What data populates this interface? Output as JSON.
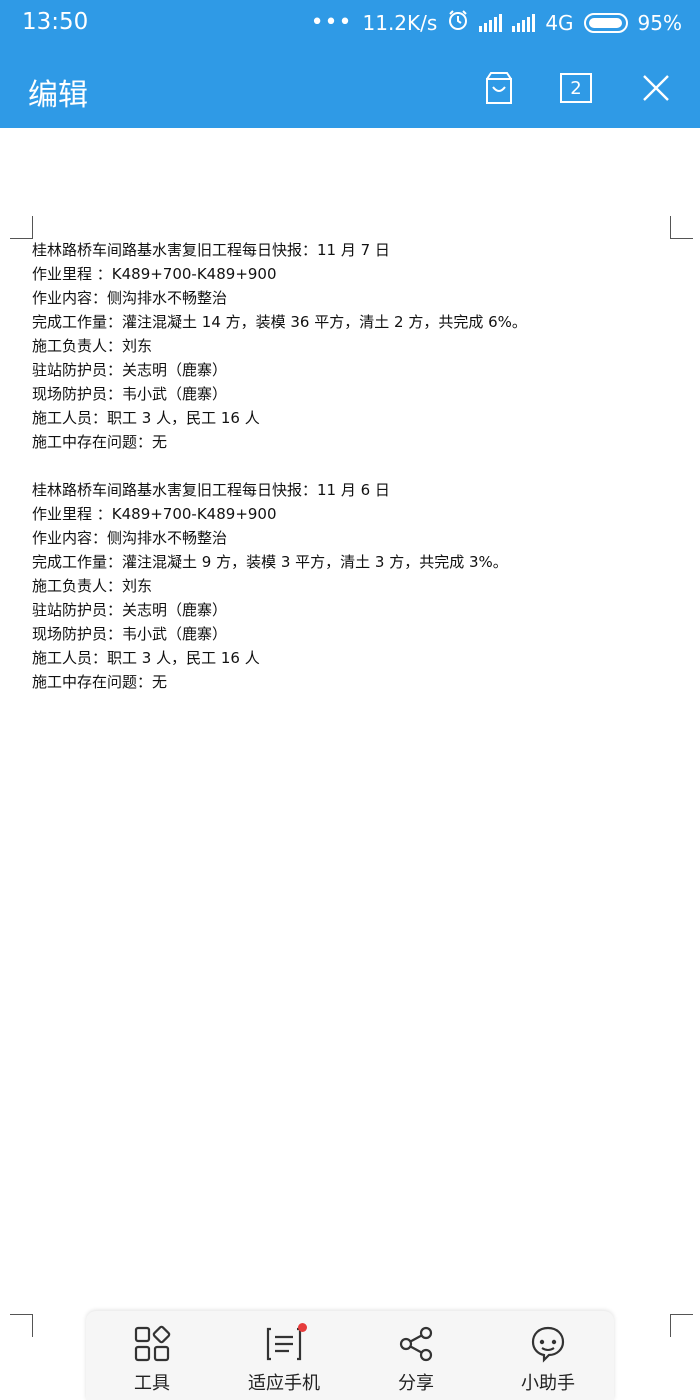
{
  "status_bar": {
    "time": "13:50",
    "dots": "•••",
    "net_speed": "11.2K/s",
    "network": "4G",
    "battery": "95%"
  },
  "app_bar": {
    "title": "编辑",
    "page_count": "2",
    "icons": [
      "save-icon",
      "pages-icon",
      "close-icon"
    ]
  },
  "document": {
    "reports": [
      {
        "lines": [
          "桂林路桥车间路基水害复旧工程每日快报：11 月 7 日",
          "作业里程 ：K489+700-K489+900",
          "作业内容：侧沟排水不畅整治",
          "完成工作量：灌注混凝土 14 方，装模 36 平方，清土 2 方，共完成 6%。",
          "施工负责人：刘东",
          "驻站防护员：关志明（鹿寨）",
          "现场防护员：韦小武（鹿寨）",
          "施工人员：职工 3 人，民工 16 人",
          "施工中存在问题：无"
        ]
      },
      {
        "lines": [
          "桂林路桥车间路基水害复旧工程每日快报：11 月 6 日",
          "作业里程 ：K489+700-K489+900",
          "作业内容：侧沟排水不畅整治",
          "完成工作量：灌注混凝土 9 方，装模 3 平方，清土 3 方，共完成 3%。",
          "施工负责人：刘东",
          "驻站防护员：关志明（鹿寨）",
          "现场防护员：韦小武（鹿寨）",
          "施工人员：职工 3 人，民工 16 人",
          "施工中存在问题：无"
        ]
      }
    ]
  },
  "bottom_toolbar": {
    "items": [
      {
        "label": "工具",
        "icon": "grid-tools-icon"
      },
      {
        "label": "适应手机",
        "icon": "fit-phone-icon"
      },
      {
        "label": "分享",
        "icon": "share-icon"
      },
      {
        "label": "小助手",
        "icon": "assistant-icon"
      }
    ]
  },
  "colors": {
    "accent": "#2f9ae6",
    "badge": "#e63c3c"
  }
}
